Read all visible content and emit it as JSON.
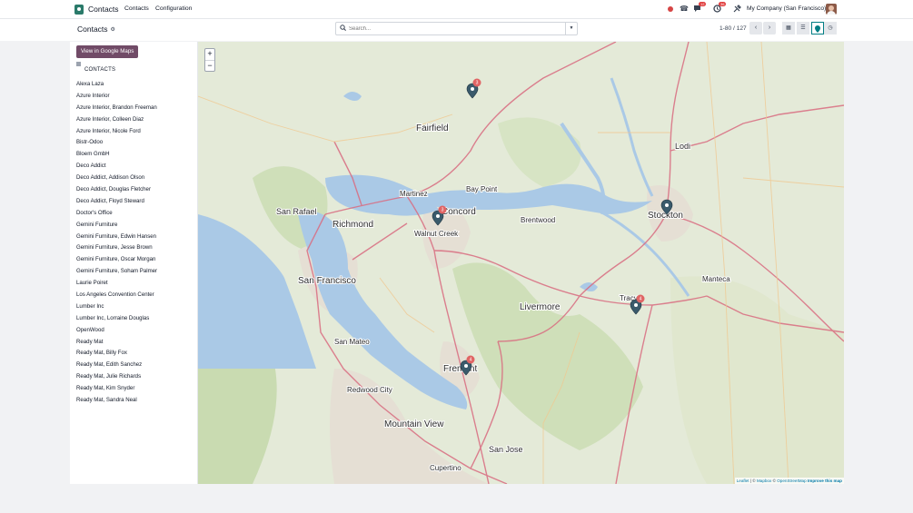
{
  "topbar": {
    "app_name": "Contacts",
    "menu": [
      "Contacts",
      "Configuration"
    ],
    "messages_badge": "12",
    "activities_badge": "36",
    "company": "My Company (San Francisco)"
  },
  "control": {
    "breadcrumb": "Contacts",
    "search_placeholder": "Search...",
    "pager": "1-80 / 127",
    "views": [
      "kanban-icon",
      "list-icon",
      "map-icon",
      "activity-icon"
    ],
    "active_view": "map-icon"
  },
  "sidepanel": {
    "google_maps_button": "View in Google Maps",
    "header": "CONTACTS",
    "contacts": [
      "Alexa Laza",
      "Azure Interior",
      "Azure Interior, Brandon Freeman",
      "Azure Interior, Colleen Diaz",
      "Azure Interior, Nicole Ford",
      "Bistr-Odoo",
      "Bloem GmbH",
      "Deco Addict",
      "Deco Addict, Addison Olson",
      "Deco Addict, Douglas Fletcher",
      "Deco Addict, Floyd Steward",
      "Doctor's Office",
      "Gemini Furniture",
      "Gemini Furniture, Edwin Hansen",
      "Gemini Furniture, Jesse Brown",
      "Gemini Furniture, Oscar Morgan",
      "Gemini Furniture, Soham Palmer",
      "Laurie Poiret",
      "Los Angeles Convention Center",
      "Lumber Inc",
      "Lumber Inc, Lorraine Douglas",
      "OpenWood",
      "Ready Mat",
      "Ready Mat, Billy Fox",
      "Ready Mat, Edith Sanchez",
      "Ready Mat, Julie Richards",
      "Ready Mat, Kim Snyder",
      "Ready Mat, Sandra Neal"
    ]
  },
  "map": {
    "zoom_in": "+",
    "zoom_out": "−",
    "places": [
      "Fairfield",
      "Lodi",
      "Stockton",
      "Martinez",
      "San Rafael",
      "Richmond",
      "Concord",
      "Bay Point",
      "Brentwood",
      "Walnut Creek",
      "San Francisco",
      "Manteca",
      "Tracy",
      "Livermore",
      "San Mateo",
      "Fremont",
      "Redwood City",
      "Mountain View",
      "Cupertino",
      "San Jose"
    ],
    "markers": [
      {
        "count": "3",
        "color": "#e06464"
      },
      {
        "count": "3",
        "color": "#e06464"
      },
      {
        "count": "",
        "color": ""
      },
      {
        "count": "4",
        "color": "#e06464"
      },
      {
        "count": "4",
        "color": "#e06464"
      }
    ],
    "attribution": {
      "leaflet": "Leaflet",
      "mapbox": "Mapbox",
      "osm": "OpenStreetMap",
      "improve": "Improve this map",
      "sep": "| ©",
      "sep2": "©"
    }
  }
}
